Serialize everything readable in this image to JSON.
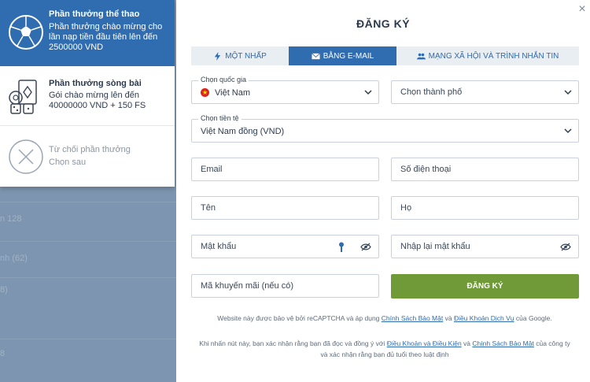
{
  "bonuses": {
    "sport": {
      "title": "Phần thưởng thể thao",
      "desc": "Phần thưởng chào mừng cho lần nạp tiền đầu tiên lên đến 2500000 VND"
    },
    "casino": {
      "title": "Phần thưởng sòng bài",
      "desc": "Gói chào mừng lên đến 40000000 VND + 150 FS"
    },
    "decline": {
      "title": "Từ chối phần thưởng",
      "desc": "Chọn sau"
    }
  },
  "background": {
    "items": [
      "n 128",
      "nh (62)",
      "8)",
      "8"
    ]
  },
  "modal": {
    "title": "ĐĂNG KÝ",
    "close_symbol": "×",
    "tabs": [
      "MỘT NHẤP",
      "BẰNG E-MAIL",
      "MẠNG XÃ HỘI VÀ TRÌNH NHẮN TIN"
    ],
    "active_tab": 1
  },
  "form": {
    "country_label": "Chọn quốc gia",
    "country_value": "Việt Nam",
    "city_placeholder": "Chọn thành phố",
    "currency_label": "Chọn tiền tệ",
    "currency_value": "Việt Nam đồng (VND)",
    "email_placeholder": "Email",
    "phone_placeholder": "Số điện thoại",
    "first_name_placeholder": "Tên",
    "last_name_placeholder": "Họ",
    "password_placeholder": "Mật khẩu",
    "password_repeat_placeholder": "Nhập lại mật khẩu",
    "promo_placeholder": "Mã khuyến mãi (nếu có)",
    "submit_label": "ĐĂNG KÝ"
  },
  "notes": {
    "recaptcha_pre": "Website này được bảo vệ bởi reCAPTCHA và áp dụng",
    "privacy_link": "Chính Sách Bảo Mật",
    "and": "và",
    "terms_link": "Điều Khoản Dịch Vụ",
    "recaptcha_post": "của Google.",
    "agree_pre": "Khi nhấn nút này, bạn xác nhận rằng bạn đã đọc và đồng ý với",
    "tc_link": "Điều Khoản và Điều Kiện",
    "and2": "và",
    "privacy2_link": "Chính Sách Bảo Mật",
    "agree_post1": "của công ty",
    "agree_post2": "và xác nhận rằng bạn đủ tuổi theo luật định"
  },
  "colors": {
    "primary": "#2f6cb0",
    "submit": "#6f9a37",
    "text": "#2b3a4d"
  }
}
